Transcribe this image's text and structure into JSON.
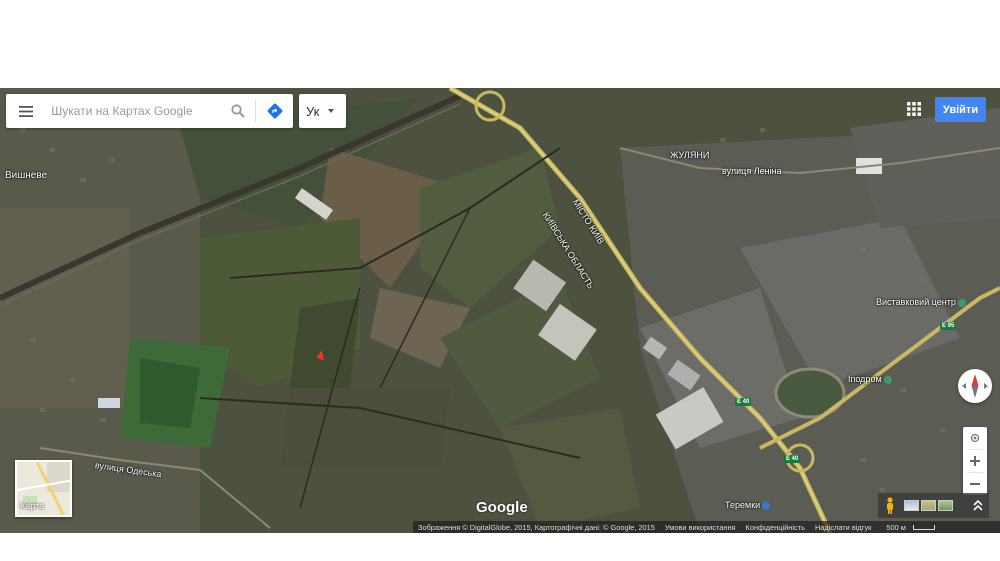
{
  "search": {
    "placeholder": "Шукати на Картах Google"
  },
  "language": {
    "label": "Ук"
  },
  "account": {
    "signin_label": "Увійти"
  },
  "map": {
    "type": "satellite",
    "labels": {
      "vyshneve": "Вишневе",
      "zhuliany": "ЖУЛЯНИ",
      "lenina_street": "вулиця Леніна",
      "misto_kyiv": "МІСТО КИЇВ",
      "kyiv_oblast": "КИЇВСЬКА ОБЛАСТЬ",
      "exhibition_center": "Виставковий центр",
      "hippodrome": "Іподром",
      "teremky": "Теремки",
      "odeska_street": "вулиця Одеська",
      "route_e40_a": "E 40",
      "route_e40_b": "E 40",
      "route_e95": "E 95"
    }
  },
  "minimap": {
    "label": "Карта"
  },
  "branding": {
    "logo_text": "Google"
  },
  "attribution": {
    "imagery": "Зображення © DigitalGlobe, 2015, Картографічні дані: © Google, 2015",
    "terms": "Умови використання",
    "privacy": "Конфіденційність",
    "feedback": "Надіслати відгук",
    "scale": "500 м"
  },
  "colors": {
    "signin_button": "#4285f4",
    "direction_icon": "#1a73e8",
    "marker": "#e8392a",
    "poi": "#3a9a6e"
  },
  "icons": [
    "menu-icon",
    "search-icon",
    "directions-icon",
    "apps-grid-icon",
    "compass-icon",
    "my-location-icon",
    "zoom-in-icon",
    "zoom-out-icon",
    "pegman-icon",
    "expand-icon"
  ]
}
